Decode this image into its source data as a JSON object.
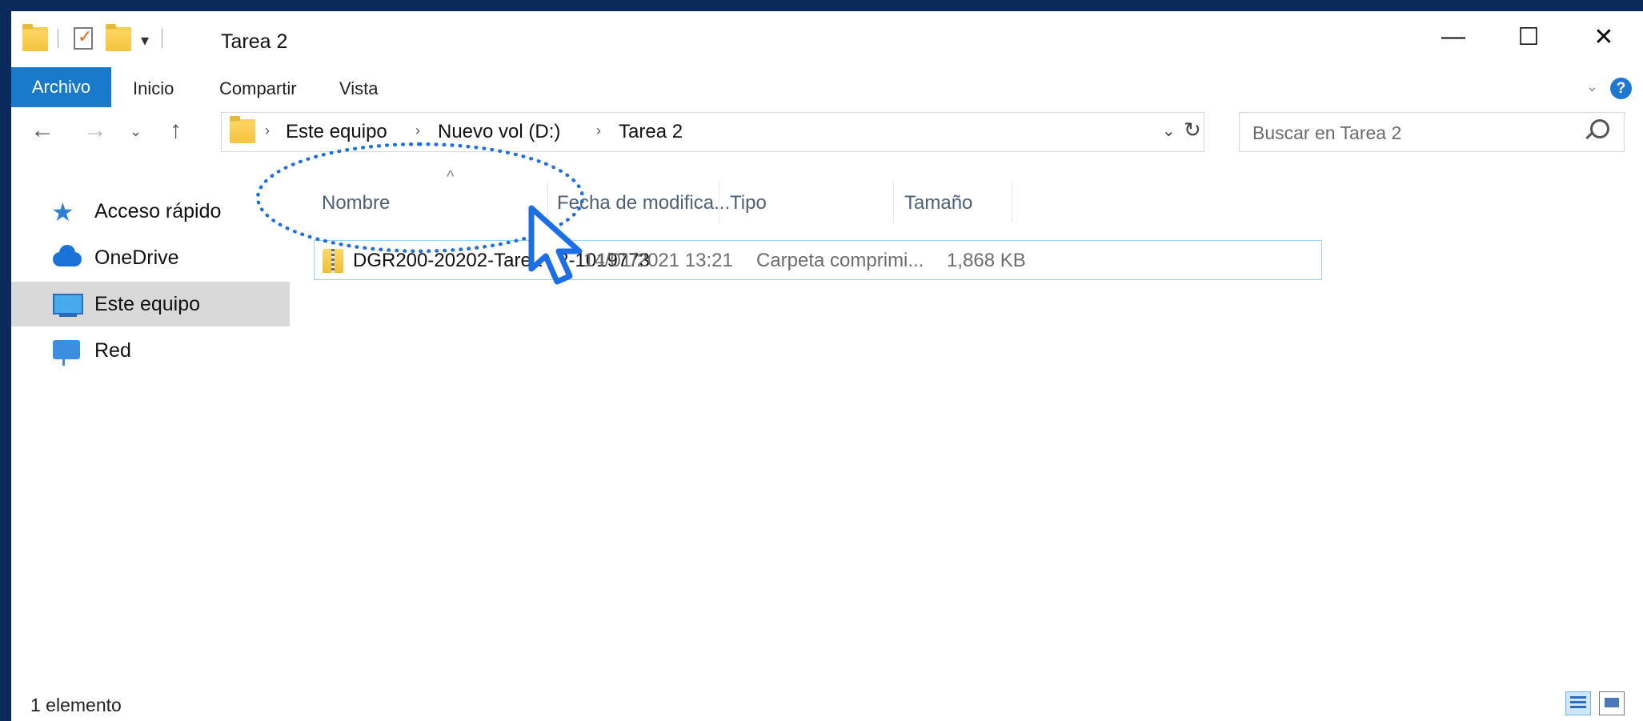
{
  "window": {
    "title": "Tarea 2",
    "controls": {
      "minimize": "—",
      "maximize": "☐",
      "close": "✕"
    }
  },
  "ribbon": {
    "tabs": [
      "Archivo",
      "Inicio",
      "Compartir",
      "Vista"
    ],
    "help": "?"
  },
  "address": {
    "crumbs": [
      "Este equipo",
      "Nuevo vol (D:)",
      "Tarea 2"
    ]
  },
  "search": {
    "placeholder": "Buscar en Tarea 2"
  },
  "sidebar": {
    "items": [
      {
        "label": "Acceso rápido",
        "icon": "star-icon"
      },
      {
        "label": "OneDrive",
        "icon": "cloud-icon"
      },
      {
        "label": "Este equipo",
        "icon": "computer-icon",
        "selected": true
      },
      {
        "label": "Red",
        "icon": "network-icon"
      }
    ]
  },
  "columns": [
    "Nombre",
    "Fecha de modifica...",
    "Tipo",
    "Tamaño"
  ],
  "files": [
    {
      "name": "DGR200-20202-Tarea 02-1019773",
      "modified": "14/01/2021 13:21",
      "type": "Carpeta comprimi...",
      "size": "1,868 KB",
      "icon": "zip-folder-icon"
    }
  ],
  "status": {
    "count": "1 elemento"
  },
  "colors": {
    "accent": "#1979ca",
    "frame": "#0b2a5c",
    "highlight": "#1c6ee6"
  }
}
